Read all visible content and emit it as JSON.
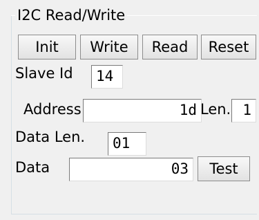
{
  "group": {
    "title": "I2C Read/Write"
  },
  "buttons": {
    "init": "Init",
    "write": "Write",
    "read": "Read",
    "reset": "Reset",
    "test": "Test"
  },
  "fields": {
    "slave_id": {
      "label": "Slave Id",
      "value": "14"
    },
    "address": {
      "label": "Address",
      "value": "1d"
    },
    "len": {
      "label": "Len.",
      "value": "1"
    },
    "data_len": {
      "label": "Data Len.",
      "value": "01"
    },
    "data": {
      "label": "Data",
      "value": "03"
    }
  }
}
